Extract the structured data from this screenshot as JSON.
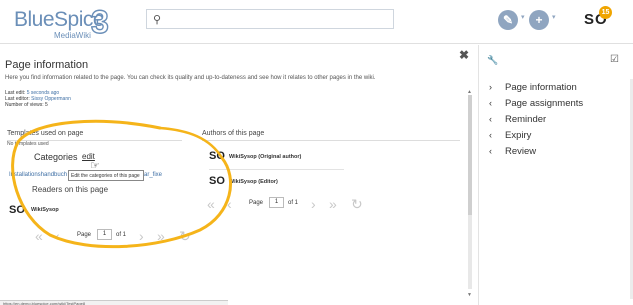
{
  "header": {
    "logo_main": "BlueSpice",
    "logo_num": "3",
    "logo_sub": "MediaWiki",
    "search_icon": "search-icon",
    "edit_icon": "pencil-icon",
    "edit_caret": "▾",
    "add_icon": "plus-icon",
    "add_caret": "▾",
    "avatar_initials": "SO",
    "notification_count": "15"
  },
  "dialog": {
    "close_icon": "close-icon",
    "title": "Page information",
    "description": "Here you find information related to the page. You can check its quality and up-to-dateness and see how it relates to other pages in the wiki.",
    "last_edit_label": "Last edit:",
    "last_edit_value": "5 seconds ago",
    "last_editor_label": "Last editor:",
    "last_editor_value": "Sissy Oppermann",
    "views_label": "Number of views:",
    "views_value": "5",
    "templates_heading": "Templates used on page",
    "no_templates": "No templates used",
    "categories_heading": "Categories",
    "categories_edit": "edit",
    "tooltip": "Edit the categories of this page",
    "install_link": "Installationshandbuch",
    "install_tail": "ar_fixe",
    "readers_heading": "Readers on this page",
    "authors_heading": "Authors of this page",
    "authors": [
      {
        "initials": "SO",
        "name": "WikiSysop (Original author)"
      },
      {
        "initials": "SO",
        "name": "WikiSysop (Editor)"
      }
    ],
    "readers": [
      {
        "initials": "SO",
        "name": "WikiSysop"
      }
    ],
    "pager": {
      "first": "«",
      "prev": "‹",
      "page_label": "Page",
      "page_value": "1",
      "of_label": "of 1",
      "next": "›",
      "last": "»",
      "refresh": "↻"
    },
    "status_url": "https://en.demo.bluespice.com/wiki/TestPage8"
  },
  "right_panel": {
    "tool_icon": "wrench-icon",
    "check_icon": "checkbox-icon",
    "items": [
      {
        "arrow": "›",
        "label": "Page information"
      },
      {
        "arrow": "‹",
        "label": "Page assignments"
      },
      {
        "arrow": "‹",
        "label": "Reminder"
      },
      {
        "arrow": "‹",
        "label": "Expiry"
      },
      {
        "arrow": "‹",
        "label": "Review"
      }
    ]
  },
  "colors": {
    "brand": "#6b8fb8",
    "link": "#3e6fa5",
    "highlight_ring": "#f5b41a",
    "notification": "#f0a500"
  }
}
